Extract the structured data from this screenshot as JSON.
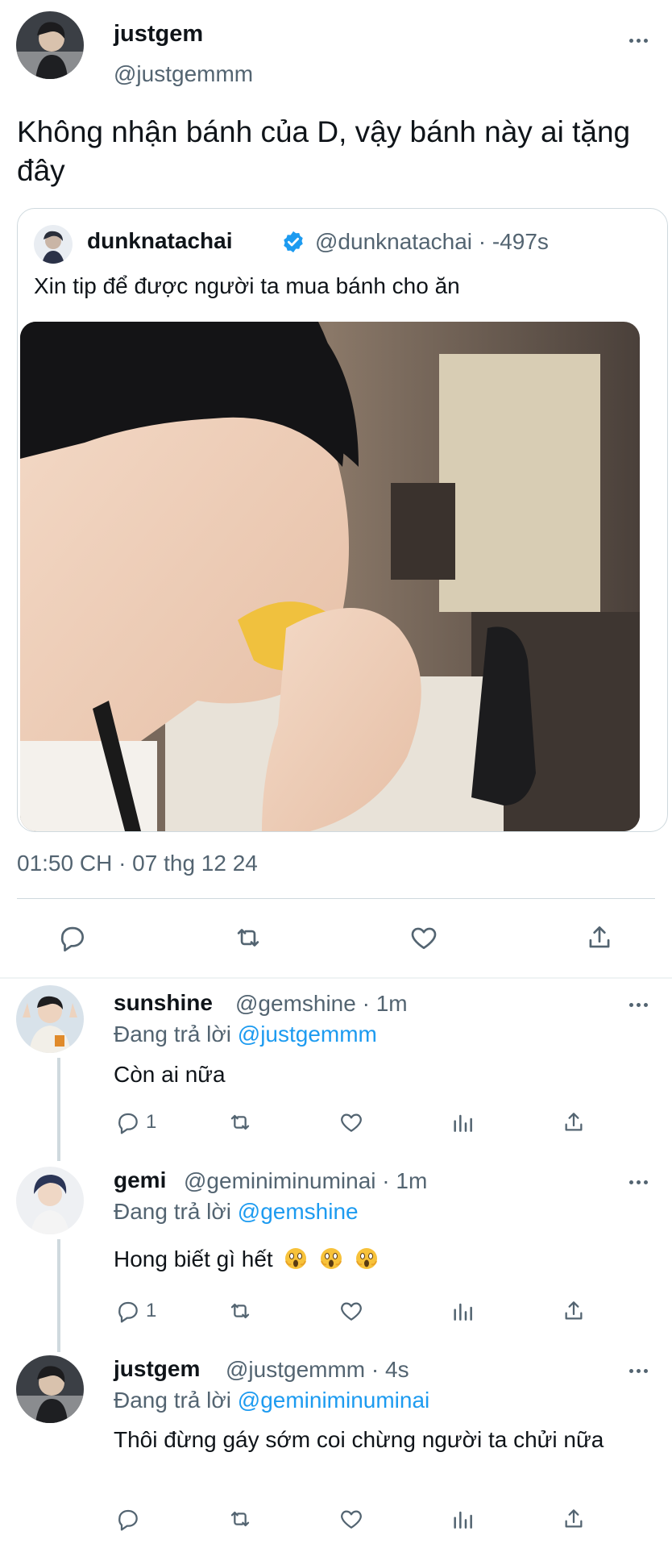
{
  "main_tweet": {
    "name": "justgem",
    "handle": "@justgemmm",
    "text": "Không nhận bánh của D, vậy bánh này ai tặng đây",
    "timestamp": "01:50 CH · 07 thg 12 24"
  },
  "quoted_tweet": {
    "name": "dunknatachai",
    "handle_time": "@dunknatachai · -497s",
    "text": "Xin tip để được người ta mua bánh cho ăn"
  },
  "main_actions": [
    "reply-icon",
    "retweet-icon",
    "like-icon",
    "share-icon"
  ],
  "replies": [
    {
      "name": "sunshine",
      "meta": "@gemshine · 1m",
      "replying_prefix": "Đang trả lời",
      "replying_to": "@justgemmm",
      "text": "Còn ai nữa",
      "reply_count": "1"
    },
    {
      "name": "gemi",
      "meta": "@geminiminuminai · 1m",
      "replying_prefix": "Đang trả lời",
      "replying_to": "@gemshine",
      "text": "Hong biết gì hết",
      "emoji": "😱😱😱",
      "reply_count": "1"
    },
    {
      "name": "justgem",
      "meta": "@justgemmm · 4s",
      "replying_prefix": "Đang trả lời",
      "replying_to": "@geminiminuminai",
      "text": "Thôi đừng gáy sớm coi chừng người ta chửi nữa",
      "reply_count": ""
    }
  ],
  "colors": {
    "accent": "#1d9bf0",
    "secondary_text": "#536471",
    "border": "#cfd9de"
  }
}
